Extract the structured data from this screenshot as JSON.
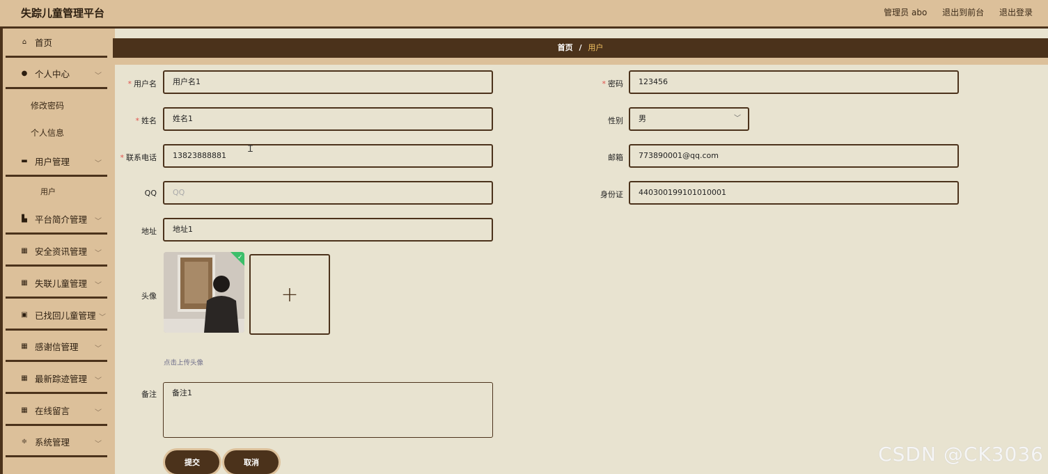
{
  "header": {
    "title": "失踪儿童管理平台",
    "admin": "管理员 abo",
    "to_front": "退出到前台",
    "logout": "退出登录"
  },
  "sidebar": {
    "items": [
      {
        "label": "首页",
        "icon": "home-icon"
      },
      {
        "label": "个人中心",
        "icon": "user-icon"
      },
      {
        "label": "用户管理",
        "icon": "briefcase-icon"
      },
      {
        "label": "平台简介管理",
        "icon": "building-icon"
      },
      {
        "label": "安全资讯管理",
        "icon": "grid-icon"
      },
      {
        "label": "失联儿童管理",
        "icon": "grid-icon"
      },
      {
        "label": "已找回儿童管理",
        "icon": "clipboard-icon"
      },
      {
        "label": "感谢信管理",
        "icon": "grid-icon"
      },
      {
        "label": "最新踪迹管理",
        "icon": "grid-icon"
      },
      {
        "label": "在线留言",
        "icon": "grid-icon"
      },
      {
        "label": "系统管理",
        "icon": "sliders-icon"
      }
    ],
    "sub_personal": [
      "修改密码",
      "个人信息"
    ],
    "sub_user": [
      "用户"
    ]
  },
  "breadcrumb": {
    "home": "首页",
    "sep": "/",
    "current": "用户"
  },
  "form": {
    "username_label": "用户名",
    "username": "用户名1",
    "password_label": "密码",
    "password": "123456",
    "name_label": "姓名",
    "name": "姓名1",
    "gender_label": "性别",
    "gender": "男",
    "phone_label": "联系电话",
    "phone": "13823888881",
    "email_label": "邮箱",
    "email": "773890001@qq.com",
    "qq_label": "QQ",
    "qq_placeholder": "QQ",
    "idcard_label": "身份证",
    "idcard": "440300199101010001",
    "address_label": "地址",
    "address": "地址1",
    "avatar_label": "头像",
    "upload_plus": "+",
    "upload_hint": "点击上传头像",
    "remark_label": "备注",
    "remark": "备注1",
    "submit": "提交",
    "cancel": "取消"
  },
  "watermark": "CSDN @CK3036",
  "colors": {
    "primary": "#4b321b",
    "sidebar_bg": "#dcc09a",
    "page_bg": "#e8e3d0",
    "required": "#e0524c",
    "crumb_current": "#f0c060"
  }
}
